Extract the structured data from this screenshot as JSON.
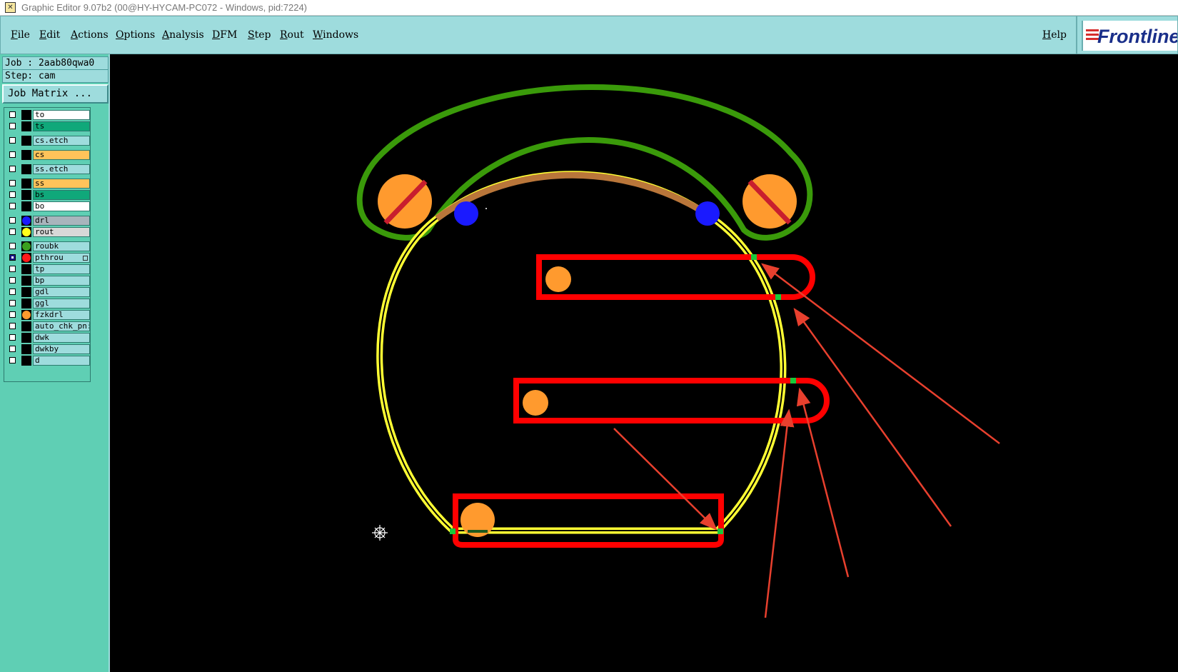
{
  "window": {
    "title": "Graphic Editor 9.07b2 (00@HY-HYCAM-PC072 - Windows, pid:7224)",
    "icon": "app-icon"
  },
  "menubar": {
    "items": [
      "File",
      "Edit",
      "Actions",
      "Options",
      "Analysis",
      "DFM",
      "Step",
      "Rout",
      "Windows"
    ],
    "help": "Help"
  },
  "logo": {
    "text": "Frontline"
  },
  "sidebar": {
    "job": "Job : 2aab80qwa0",
    "step": "Step: cam",
    "job_matrix": "Job Matrix ..."
  },
  "layers": [
    {
      "name": "to",
      "bg": "#ffffff",
      "dot": ""
    },
    {
      "name": "ts",
      "bg": "#10a87a",
      "dot": ""
    },
    {
      "name": "cs.etch",
      "bg": "#9edcdd",
      "dot": ""
    },
    {
      "name": "cs",
      "bg": "#ffc35a",
      "dot": ""
    },
    {
      "name": "ss.etch",
      "bg": "#9edcdd",
      "dot": ""
    },
    {
      "name": "ss",
      "bg": "#ffc35a",
      "dot": ""
    },
    {
      "name": "bs",
      "bg": "#10a87a",
      "dot": ""
    },
    {
      "name": "bo",
      "bg": "#ffffff",
      "dot": ""
    },
    {
      "name": "drl",
      "bg": "#a8b4bc",
      "dot": "#1a1aff"
    },
    {
      "name": "rout",
      "bg": "#d8d8d8",
      "dot": "#ffff1a"
    },
    {
      "name": "roubk",
      "bg": "#9edcdd",
      "dot": "#3aa01e"
    },
    {
      "name": "pthrou",
      "bg": "#9edcdd",
      "dot": "#ff1a1a",
      "checked": true,
      "flag": true
    },
    {
      "name": "tp",
      "bg": "#9edcdd",
      "dot": ""
    },
    {
      "name": "bp",
      "bg": "#9edcdd",
      "dot": ""
    },
    {
      "name": "gdl",
      "bg": "#9edcdd",
      "dot": ""
    },
    {
      "name": "ggl",
      "bg": "#9edcdd",
      "dot": ""
    },
    {
      "name": "fzkdrl",
      "bg": "#9edcdd",
      "dot": "#ff9a2e"
    },
    {
      "name": "auto_chk_pn:",
      "bg": "#9edcdd",
      "dot": ""
    },
    {
      "name": "dwk",
      "bg": "#9edcdd",
      "dot": ""
    },
    {
      "name": "dwkby",
      "bg": "#9edcdd",
      "dot": ""
    },
    {
      "name": "d",
      "bg": "#9edcdd",
      "dot": ""
    }
  ],
  "colors": {
    "accent": "#9edcdd",
    "sidebar": "#5fcfb4",
    "rout": "#ffff33",
    "pthrou": "#ff0000",
    "roubk": "#3a9a0a",
    "fzkdrl": "#ff9a2e",
    "drl": "#1a1aff",
    "arrow": "#e8402e"
  }
}
